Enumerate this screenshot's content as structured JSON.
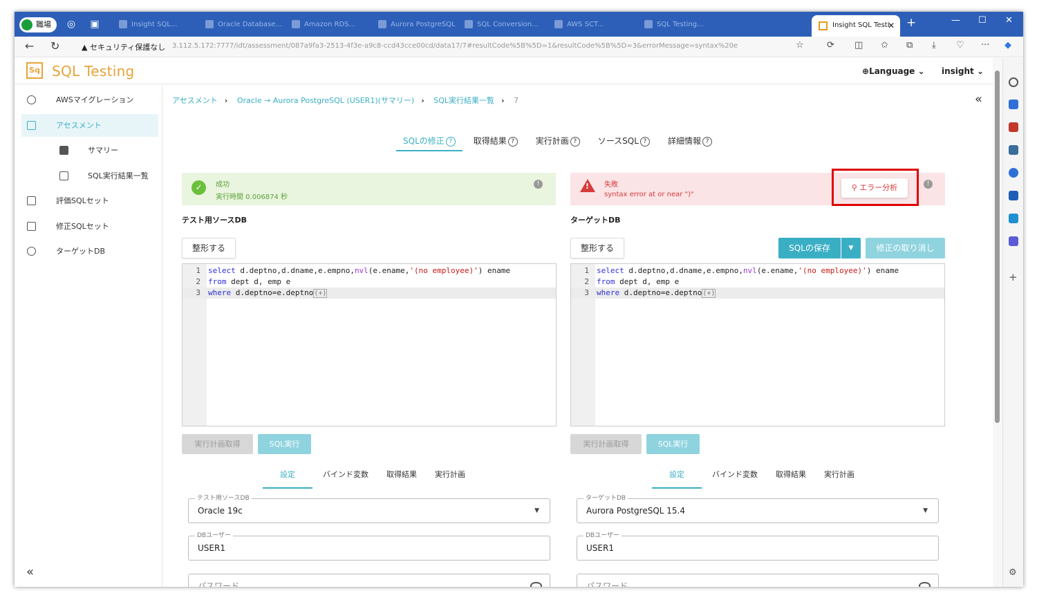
{
  "browser": {
    "profile_label": "職場",
    "background_tabs": [
      "Insight SQL...",
      "Oracle Database...",
      "Amazon RDS...",
      "Aurora PostgreSQL...",
      "SQL Conversion...",
      "AWS SCT...",
      "SQL Testing..."
    ],
    "active_tab_title": "Insight SQL Testi",
    "security_warning": "セキュリティ保護なし",
    "url": "3.112.5.172:7777/idt/assessment/087a9fa3-2513-4f3e-a9c8-ccd43cce00cd/data17/7#resultCode%5B%5D=1&resultCode%5B%5D=3&errorMessage=syntax%20e"
  },
  "app": {
    "logo_mark": "Sq",
    "title": "SQL Testing",
    "language_menu": "Language",
    "user_menu": "insight"
  },
  "sidebar": {
    "items": [
      {
        "label": "AWSマイグレーション",
        "icon": "database-cloud-icon"
      },
      {
        "label": "アセスメント",
        "icon": "document-icon"
      },
      {
        "label": "サマリー",
        "icon": "dashboard-icon"
      },
      {
        "label": "SQL実行結果一覧",
        "icon": "list-icon"
      },
      {
        "label": "評価SQLセット",
        "icon": "clipboard-icon"
      },
      {
        "label": "修正SQLセット",
        "icon": "clipboard-check-icon"
      },
      {
        "label": "ターゲットDB",
        "icon": "database-icon"
      }
    ],
    "collapse": "«"
  },
  "breadcrumb": {
    "items": [
      "アセスメント",
      "Oracle → Aurora PostgreSQL (USER1)(サマリー)",
      "SQL実行結果一覧",
      "7"
    ],
    "sep": "›"
  },
  "collapse_right": "«",
  "tabs": [
    {
      "label": "SQLの修正",
      "active": true
    },
    {
      "label": "取得結果"
    },
    {
      "label": "実行計画"
    },
    {
      "label": "ソースSQL"
    },
    {
      "label": "詳細情報"
    }
  ],
  "help_glyph": "?",
  "source": {
    "status": "成功",
    "detail": "実行時間 0.006874 秒",
    "section_title": "テスト用ソースDB",
    "format_button": "整形する",
    "code": [
      {
        "n": "1",
        "segs": [
          [
            "kw",
            "select"
          ],
          [
            "pl",
            " d.deptno,d.dname,e.empno,"
          ],
          [
            "fn",
            "nvl"
          ],
          [
            "pl",
            "(e.ename,"
          ],
          [
            "str",
            "'(no employee)'"
          ],
          [
            "pl",
            ") ename"
          ]
        ]
      },
      {
        "n": "2",
        "segs": [
          [
            "kw",
            "from"
          ],
          [
            "pl",
            " dept d, emp e"
          ]
        ]
      },
      {
        "n": "3",
        "segs": [
          [
            "kw",
            "where"
          ],
          [
            "pl",
            " d.deptno=e.deptno"
          ],
          [
            "paren",
            "(+)"
          ]
        ]
      }
    ],
    "plan_button": "実行計画取得",
    "run_button": "SQL実行",
    "subtabs": [
      "設定",
      "バインド変数",
      "取得結果",
      "実行計画"
    ],
    "db_label": "テスト用ソースDB",
    "db_value": "Oracle 19c",
    "user_label": "DBユーザー",
    "user_value": "USER1",
    "password_placeholder": "パスワード"
  },
  "target": {
    "status": "失敗",
    "detail": "syntax error at or near \")\"",
    "error_button": "エラー分析",
    "section_title": "ターゲットDB",
    "format_button": "整形する",
    "save_button": "SQLの保存",
    "undo_button": "修正の取り消し",
    "code": [
      {
        "n": "1",
        "segs": [
          [
            "kw",
            "select"
          ],
          [
            "pl",
            " d.deptno,d.dname,e.empno,"
          ],
          [
            "fn",
            "nvl"
          ],
          [
            "pl",
            "(e.ename,"
          ],
          [
            "str",
            "'(no employee)'"
          ],
          [
            "pl",
            ") ename"
          ]
        ]
      },
      {
        "n": "2",
        "segs": [
          [
            "kw",
            "from"
          ],
          [
            "pl",
            " dept d, emp e"
          ]
        ]
      },
      {
        "n": "3",
        "segs": [
          [
            "kw",
            "where"
          ],
          [
            "pl",
            " d.deptno=e.deptno"
          ],
          [
            "paren",
            "(+)"
          ]
        ]
      }
    ],
    "plan_button": "実行計画取得",
    "run_button": "SQL実行",
    "subtabs": [
      "設定",
      "バインド変数",
      "取得結果",
      "実行計画"
    ],
    "db_label": "ターゲットDB",
    "db_value": "Aurora PostgreSQL 15.4",
    "user_label": "DBユーザー",
    "user_value": "USER1",
    "password_placeholder": "パスワード"
  },
  "colors": {
    "accent": "#3aafc4",
    "success": "#6bbf3a",
    "error": "#d73a3a",
    "brand": "#e8a33a",
    "highlight_box": "#e00000"
  }
}
